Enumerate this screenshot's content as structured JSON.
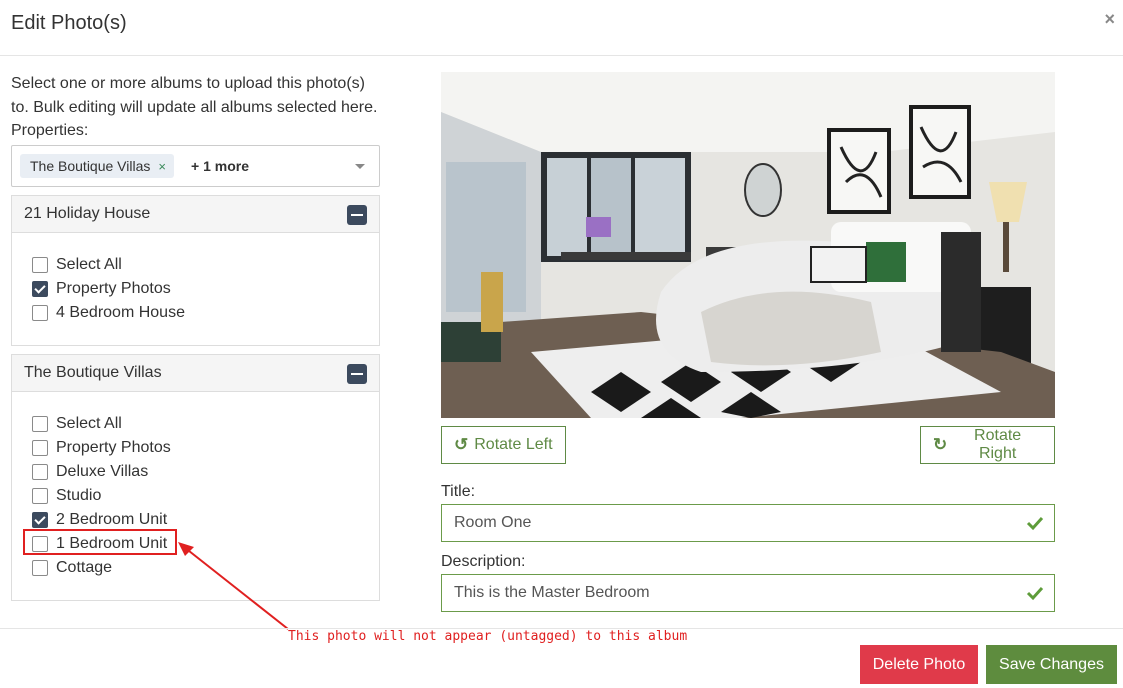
{
  "modal": {
    "title": "Edit Photo(s)",
    "close_icon": "×"
  },
  "left": {
    "intro": "Select one or more albums to upload this photo(s) to. Bulk editing will update all albums selected here.",
    "properties_label": "Properties:",
    "selected_tag": "The Boutique Villas",
    "tag_remove": "×",
    "more_label": "+ 1 more",
    "groups": [
      {
        "title": "21 Holiday House",
        "items": [
          {
            "label": "Select All",
            "checked": false
          },
          {
            "label": "Property Photos",
            "checked": true
          },
          {
            "label": "4 Bedroom House",
            "checked": false
          }
        ]
      },
      {
        "title": "The Boutique Villas",
        "items": [
          {
            "label": "Select All",
            "checked": false
          },
          {
            "label": "Property Photos",
            "checked": false
          },
          {
            "label": "Deluxe Villas",
            "checked": false
          },
          {
            "label": "Studio",
            "checked": false
          },
          {
            "label": "2 Bedroom Unit",
            "checked": true
          },
          {
            "label": "1 Bedroom Unit",
            "checked": false
          },
          {
            "label": "Cottage",
            "checked": false
          }
        ]
      }
    ]
  },
  "annotation": "This photo will not appear (untagged) to this album",
  "right": {
    "rotate_left": "Rotate Left",
    "rotate_right": "Rotate Right",
    "title_label": "Title:",
    "title_value": "Room One",
    "description_label": "Description:",
    "description_value": "This is the Master Bedroom"
  },
  "footer": {
    "delete_label": "Delete Photo",
    "save_label": "Save Changes"
  },
  "colors": {
    "accent_green": "#5e8c3e",
    "danger_red": "#e03a4a",
    "annotation_red": "#e02020",
    "checkbox_navy": "#3c4a5e"
  }
}
